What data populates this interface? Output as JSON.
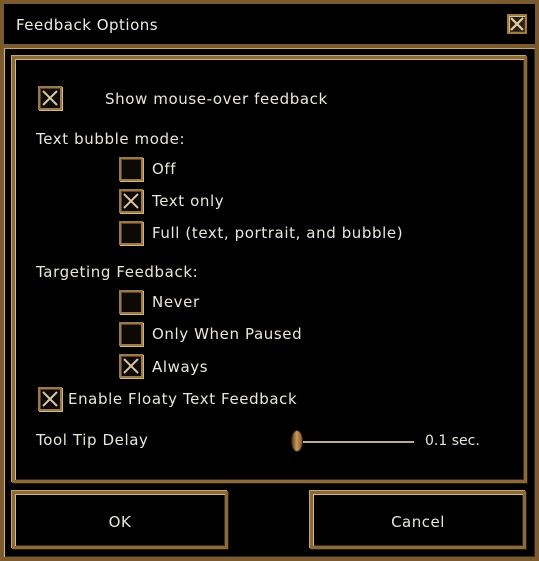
{
  "window": {
    "title": "Feedback Options",
    "close_icon": "close-x-icon"
  },
  "options": {
    "mouseover": {
      "label": "Show mouse-over feedback",
      "checked": true
    },
    "text_bubble": {
      "heading": "Text bubble mode:",
      "items": [
        {
          "label": "Off",
          "checked": false
        },
        {
          "label": "Text only",
          "checked": true
        },
        {
          "label": "Full (text, portrait, and bubble)",
          "checked": false
        }
      ]
    },
    "targeting": {
      "heading": "Targeting Feedback:",
      "items": [
        {
          "label": "Never",
          "checked": false
        },
        {
          "label": "Only When Paused",
          "checked": false
        },
        {
          "label": "Always",
          "checked": true
        }
      ]
    },
    "floaty": {
      "label": "Enable Floaty Text Feedback",
      "checked": true
    },
    "tooltip": {
      "label": "Tool Tip Delay",
      "value_text": "0.1 sec.",
      "slider_fraction": 0.0
    }
  },
  "buttons": {
    "ok": "OK",
    "cancel": "Cancel"
  },
  "colors": {
    "bronze": "#8a6a3c",
    "text": "#ece6da",
    "background": "#000000"
  }
}
